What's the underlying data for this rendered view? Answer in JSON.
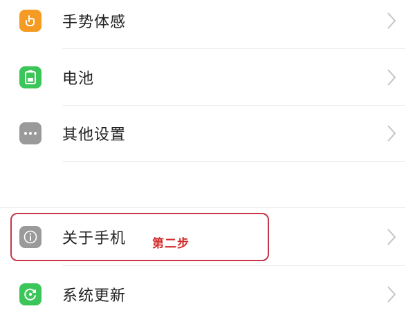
{
  "settings": {
    "items": [
      {
        "label": "手势体感",
        "icon": "gesture-icon",
        "color": "#f59a23"
      },
      {
        "label": "电池",
        "icon": "battery-icon",
        "color": "#3cc65a"
      },
      {
        "label": "其他设置",
        "icon": "more-dots-icon",
        "color": "#9a9a9a"
      },
      {
        "label": "关于手机",
        "icon": "info-icon",
        "color": "#9a9a9a"
      },
      {
        "label": "系统更新",
        "icon": "system-update-icon",
        "color": "#3cc65a"
      }
    ]
  },
  "annotation": {
    "text": "第二步",
    "color": "#d22a2a"
  }
}
